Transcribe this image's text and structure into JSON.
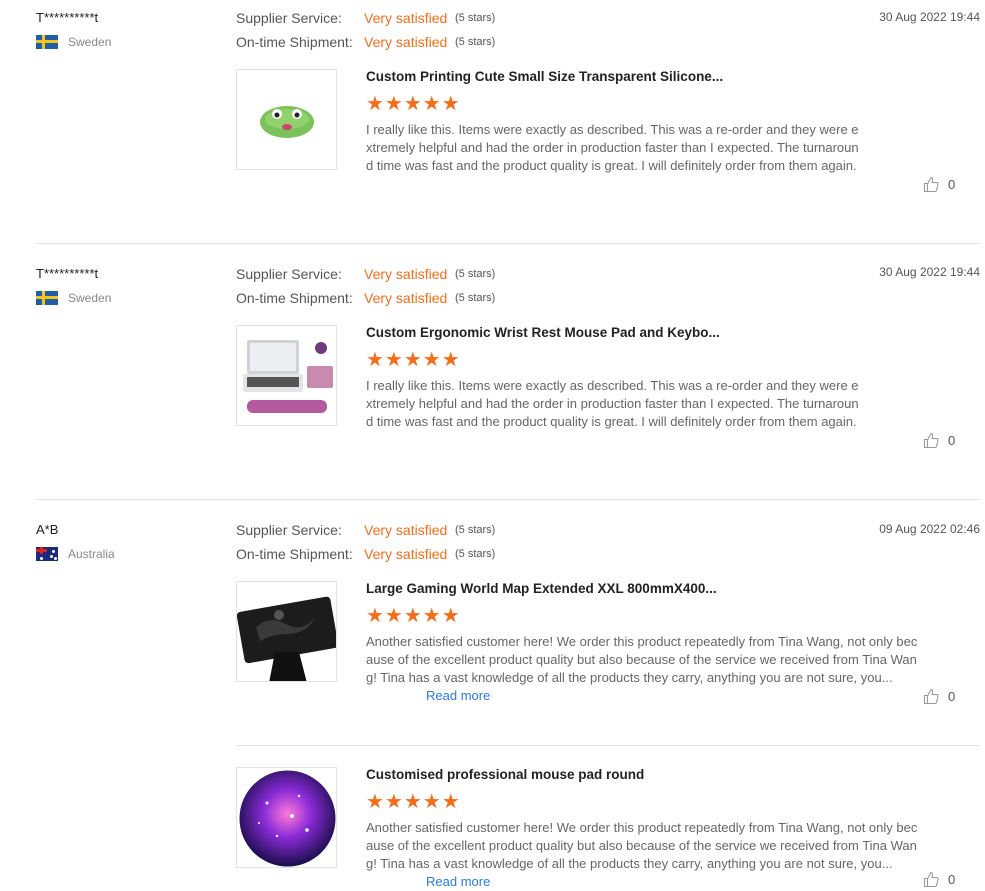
{
  "labels": {
    "supplier_service": "Supplier Service:",
    "ontime_shipment": "On-time Shipment:",
    "read_more": "Read more"
  },
  "colors": {
    "accent": "#f46d19",
    "link": "#2a7ae4"
  },
  "reviews": [
    {
      "user": "T**********t",
      "country": "Sweden",
      "country_flag": "sweden-flag",
      "date": "30 Aug 2022 19:44",
      "supplier_service": "Very satisfied",
      "supplier_stars": "(5 stars)",
      "shipment": "Very satisfied",
      "shipment_stars": "(5 stars)",
      "products": [
        {
          "title": "Custom Printing Cute Small Size Transparent Silicone...",
          "rating": 5,
          "stars_text": "★★★★★",
          "text": "I really like this. Items were exactly as described. This was a re-order and they were extremely helpful and had the order in production faster than I expected. The turnaround time was fast and the product quality is great. I will definitely order from them again.",
          "likes": "0"
        }
      ]
    },
    {
      "user": "T**********t",
      "country": "Sweden",
      "country_flag": "sweden-flag",
      "date": "30 Aug 2022 19:44",
      "supplier_service": "Very satisfied",
      "supplier_stars": "(5 stars)",
      "shipment": "Very satisfied",
      "shipment_stars": "(5 stars)",
      "products": [
        {
          "title": "Custom Ergonomic Wrist Rest Mouse Pad and Keybo...",
          "rating": 5,
          "stars_text": "★★★★★",
          "text": "I really like this. Items were exactly as described. This was a re-order and they were extremely helpful and had the order in production faster than I expected. The turnaround time was fast and the product quality is great. I will definitely order from them again.",
          "likes": "0"
        }
      ]
    },
    {
      "user": "A*B",
      "country": "Australia",
      "country_flag": "australia-flag",
      "date": "09 Aug 2022 02:46",
      "supplier_service": "Very satisfied",
      "supplier_stars": "(5 stars)",
      "shipment": "Very satisfied",
      "shipment_stars": "(5 stars)",
      "products": [
        {
          "title": "Large Gaming World Map Extended XXL 800mmX400...",
          "rating": 5,
          "stars_text": "★★★★★",
          "text": "Another satisfied customer here! We order this product repeatedly from Tina Wang, not only because of the excellent product quality but also because of the service we received from Tina Wang! Tina has a vast knowledge of all the products they carry, anything you are not sure, you...",
          "likes": "0"
        },
        {
          "title": "Customised professional mouse pad round",
          "rating": 5,
          "stars_text": "★★★★★",
          "text": "Another satisfied customer here! We order this product repeatedly from Tina Wang, not only because of the excellent product quality but also because of the service we received from Tina Wang! Tina has a vast knowledge of all the products they carry, anything you are not sure, you...",
          "likes": "0"
        }
      ]
    }
  ]
}
